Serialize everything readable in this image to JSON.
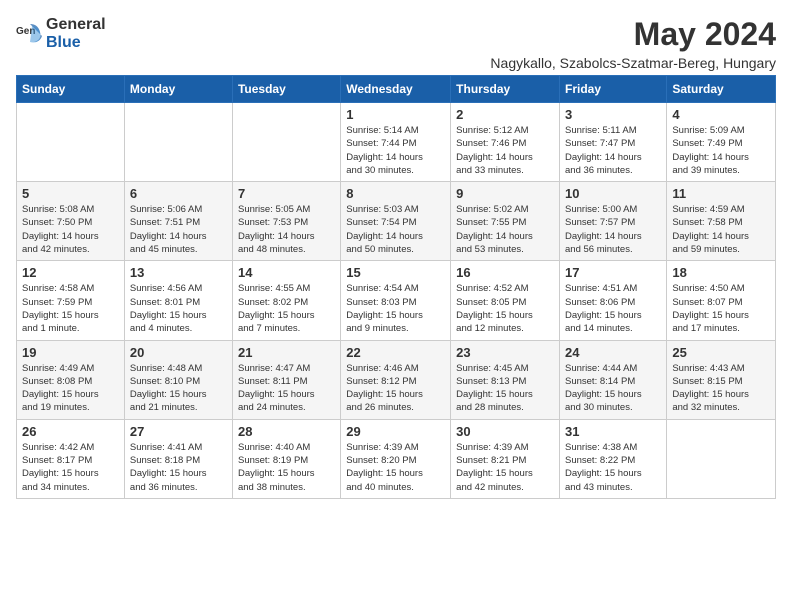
{
  "logo": {
    "general": "General",
    "blue": "Blue"
  },
  "title": "May 2024",
  "location": "Nagykallo, Szabolcs-Szatmar-Bereg, Hungary",
  "weekdays": [
    "Sunday",
    "Monday",
    "Tuesday",
    "Wednesday",
    "Thursday",
    "Friday",
    "Saturday"
  ],
  "weeks": [
    [
      {
        "day": "",
        "info": ""
      },
      {
        "day": "",
        "info": ""
      },
      {
        "day": "",
        "info": ""
      },
      {
        "day": "1",
        "info": "Sunrise: 5:14 AM\nSunset: 7:44 PM\nDaylight: 14 hours\nand 30 minutes."
      },
      {
        "day": "2",
        "info": "Sunrise: 5:12 AM\nSunset: 7:46 PM\nDaylight: 14 hours\nand 33 minutes."
      },
      {
        "day": "3",
        "info": "Sunrise: 5:11 AM\nSunset: 7:47 PM\nDaylight: 14 hours\nand 36 minutes."
      },
      {
        "day": "4",
        "info": "Sunrise: 5:09 AM\nSunset: 7:49 PM\nDaylight: 14 hours\nand 39 minutes."
      }
    ],
    [
      {
        "day": "5",
        "info": "Sunrise: 5:08 AM\nSunset: 7:50 PM\nDaylight: 14 hours\nand 42 minutes."
      },
      {
        "day": "6",
        "info": "Sunrise: 5:06 AM\nSunset: 7:51 PM\nDaylight: 14 hours\nand 45 minutes."
      },
      {
        "day": "7",
        "info": "Sunrise: 5:05 AM\nSunset: 7:53 PM\nDaylight: 14 hours\nand 48 minutes."
      },
      {
        "day": "8",
        "info": "Sunrise: 5:03 AM\nSunset: 7:54 PM\nDaylight: 14 hours\nand 50 minutes."
      },
      {
        "day": "9",
        "info": "Sunrise: 5:02 AM\nSunset: 7:55 PM\nDaylight: 14 hours\nand 53 minutes."
      },
      {
        "day": "10",
        "info": "Sunrise: 5:00 AM\nSunset: 7:57 PM\nDaylight: 14 hours\nand 56 minutes."
      },
      {
        "day": "11",
        "info": "Sunrise: 4:59 AM\nSunset: 7:58 PM\nDaylight: 14 hours\nand 59 minutes."
      }
    ],
    [
      {
        "day": "12",
        "info": "Sunrise: 4:58 AM\nSunset: 7:59 PM\nDaylight: 15 hours\nand 1 minute."
      },
      {
        "day": "13",
        "info": "Sunrise: 4:56 AM\nSunset: 8:01 PM\nDaylight: 15 hours\nand 4 minutes."
      },
      {
        "day": "14",
        "info": "Sunrise: 4:55 AM\nSunset: 8:02 PM\nDaylight: 15 hours\nand 7 minutes."
      },
      {
        "day": "15",
        "info": "Sunrise: 4:54 AM\nSunset: 8:03 PM\nDaylight: 15 hours\nand 9 minutes."
      },
      {
        "day": "16",
        "info": "Sunrise: 4:52 AM\nSunset: 8:05 PM\nDaylight: 15 hours\nand 12 minutes."
      },
      {
        "day": "17",
        "info": "Sunrise: 4:51 AM\nSunset: 8:06 PM\nDaylight: 15 hours\nand 14 minutes."
      },
      {
        "day": "18",
        "info": "Sunrise: 4:50 AM\nSunset: 8:07 PM\nDaylight: 15 hours\nand 17 minutes."
      }
    ],
    [
      {
        "day": "19",
        "info": "Sunrise: 4:49 AM\nSunset: 8:08 PM\nDaylight: 15 hours\nand 19 minutes."
      },
      {
        "day": "20",
        "info": "Sunrise: 4:48 AM\nSunset: 8:10 PM\nDaylight: 15 hours\nand 21 minutes."
      },
      {
        "day": "21",
        "info": "Sunrise: 4:47 AM\nSunset: 8:11 PM\nDaylight: 15 hours\nand 24 minutes."
      },
      {
        "day": "22",
        "info": "Sunrise: 4:46 AM\nSunset: 8:12 PM\nDaylight: 15 hours\nand 26 minutes."
      },
      {
        "day": "23",
        "info": "Sunrise: 4:45 AM\nSunset: 8:13 PM\nDaylight: 15 hours\nand 28 minutes."
      },
      {
        "day": "24",
        "info": "Sunrise: 4:44 AM\nSunset: 8:14 PM\nDaylight: 15 hours\nand 30 minutes."
      },
      {
        "day": "25",
        "info": "Sunrise: 4:43 AM\nSunset: 8:15 PM\nDaylight: 15 hours\nand 32 minutes."
      }
    ],
    [
      {
        "day": "26",
        "info": "Sunrise: 4:42 AM\nSunset: 8:17 PM\nDaylight: 15 hours\nand 34 minutes."
      },
      {
        "day": "27",
        "info": "Sunrise: 4:41 AM\nSunset: 8:18 PM\nDaylight: 15 hours\nand 36 minutes."
      },
      {
        "day": "28",
        "info": "Sunrise: 4:40 AM\nSunset: 8:19 PM\nDaylight: 15 hours\nand 38 minutes."
      },
      {
        "day": "29",
        "info": "Sunrise: 4:39 AM\nSunset: 8:20 PM\nDaylight: 15 hours\nand 40 minutes."
      },
      {
        "day": "30",
        "info": "Sunrise: 4:39 AM\nSunset: 8:21 PM\nDaylight: 15 hours\nand 42 minutes."
      },
      {
        "day": "31",
        "info": "Sunrise: 4:38 AM\nSunset: 8:22 PM\nDaylight: 15 hours\nand 43 minutes."
      },
      {
        "day": "",
        "info": ""
      }
    ]
  ]
}
